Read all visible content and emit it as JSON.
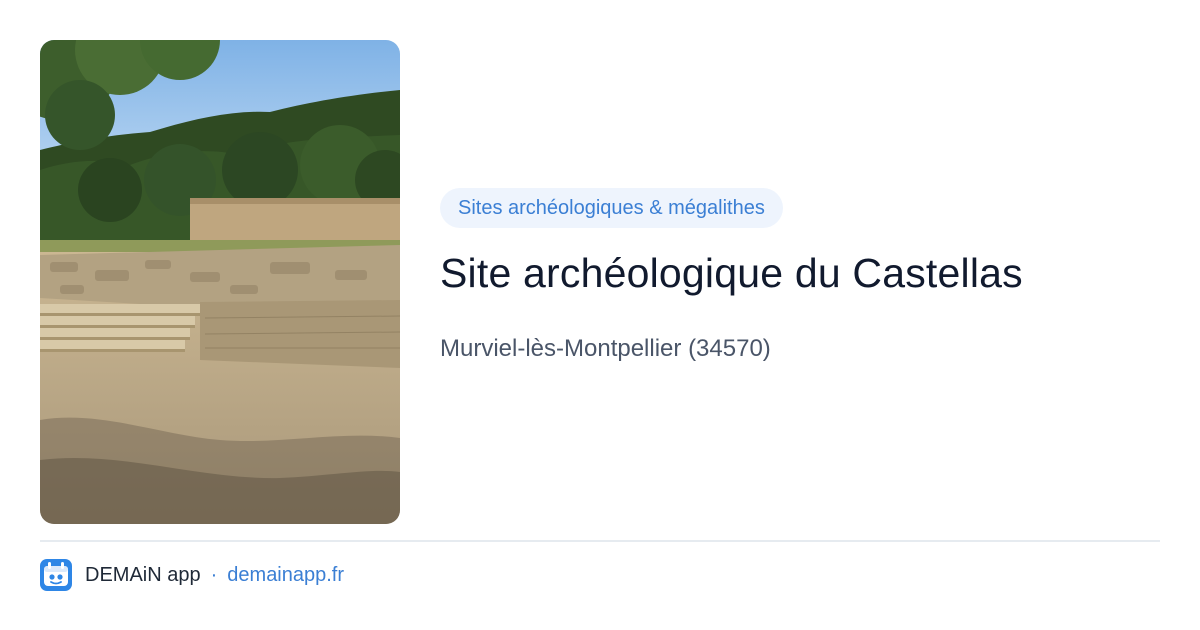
{
  "preview": {
    "image": {
      "subject": "archaeological ruins photo",
      "colors": {
        "sky": "#8fbfea",
        "foliage": "#2f4a22",
        "ground": "#d9c7a6",
        "stone": "#b9a88b"
      }
    },
    "category": "Sites archéologiques & mégalithes",
    "title": "Site archéologique du Castellas",
    "location": "Murviel-lès-Montpellier (34570)"
  },
  "footer": {
    "logo_icon": "demain-app-icon",
    "app_name": "DEMAiN app",
    "separator": "·",
    "url": "demainapp.fr"
  },
  "colors": {
    "accent": "#3b7fd4",
    "pill_bg": "#eef4fd",
    "title": "#111a2e",
    "subtitle": "#4a5568"
  }
}
